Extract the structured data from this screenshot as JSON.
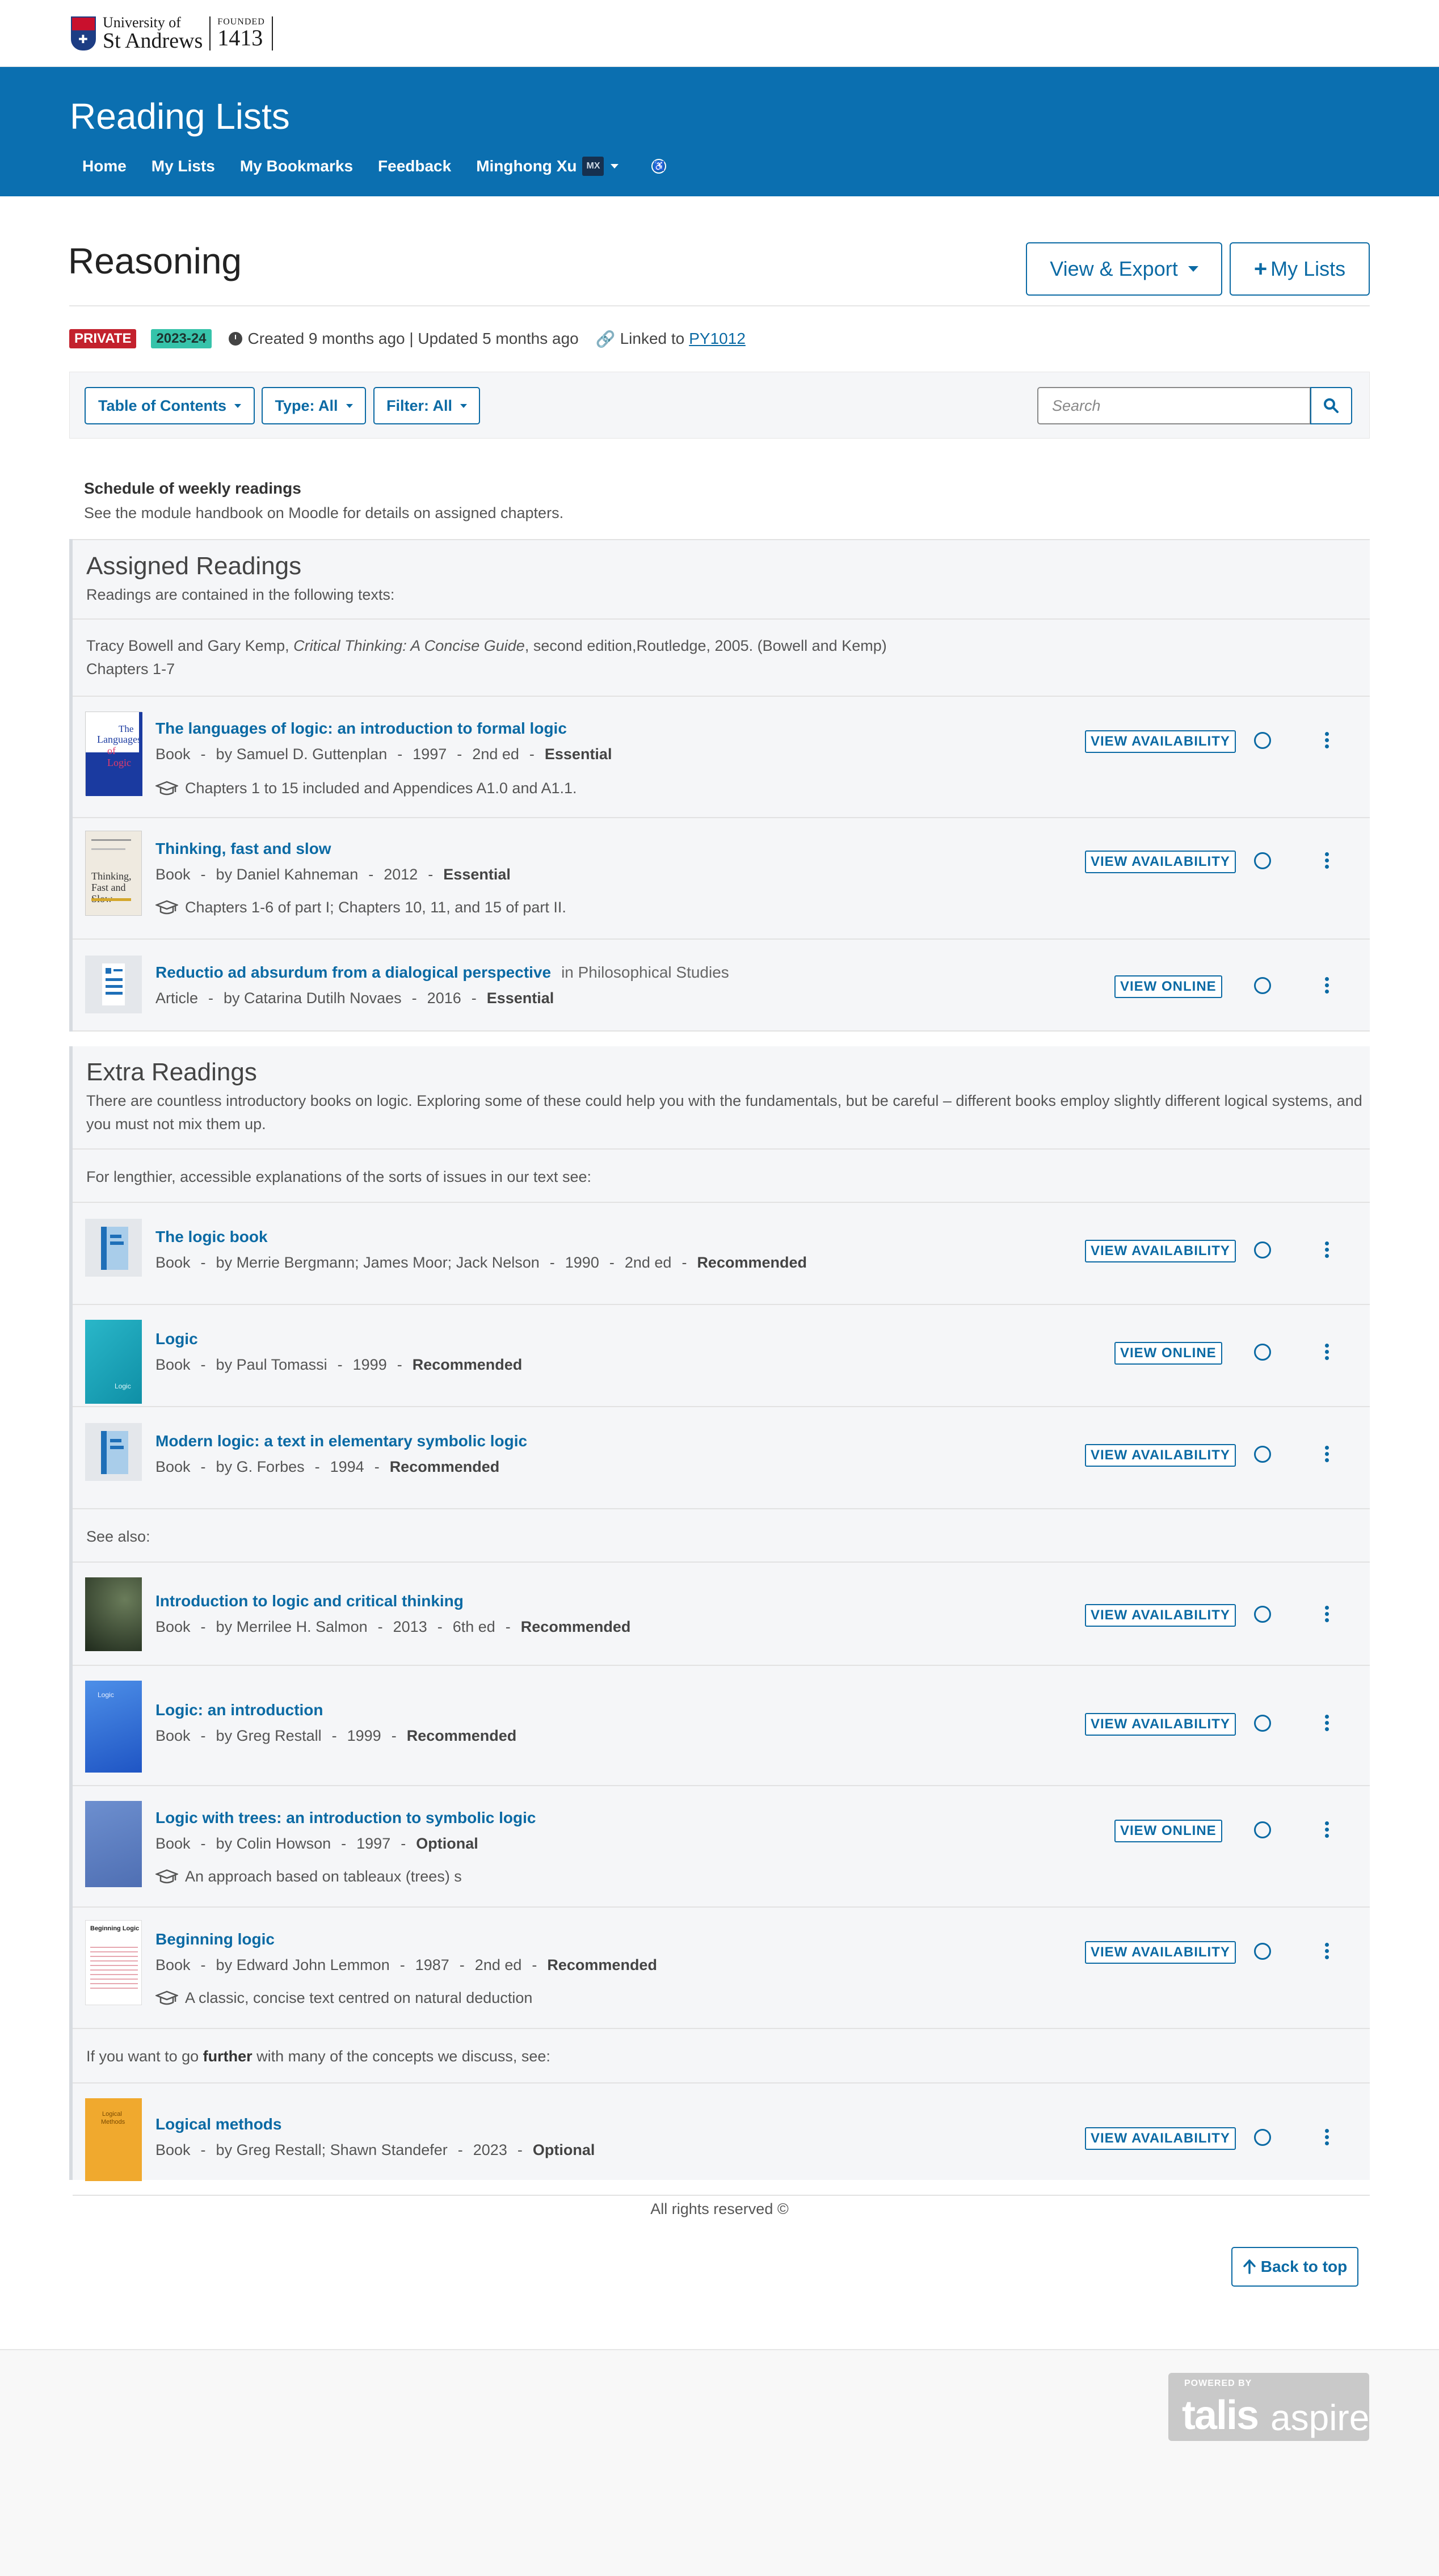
{
  "header": {
    "logo": {
      "line1": "University of",
      "line2": "St Andrews",
      "founded_label": "FOUNDED",
      "founded_year": "1413"
    },
    "app_title": "Reading Lists",
    "nav": {
      "home": "Home",
      "my_lists": "My Lists",
      "my_bookmarks": "My Bookmarks",
      "feedback": "Feedback",
      "user_name": "Minghong Xu",
      "user_initials": "MX"
    }
  },
  "page": {
    "title": "Reasoning",
    "view_export_label": "View & Export",
    "my_lists_label": "My Lists",
    "status_badge": "PRIVATE",
    "year_badge": "2023-24",
    "created_updated": "Created 9 months ago | Updated 5 months ago",
    "linked_label": "Linked to",
    "linked_module": "PY1012"
  },
  "toolbar": {
    "toc_label": "Table of Contents",
    "type_label": "Type: All",
    "filter_label": "Filter: All",
    "search_placeholder": "Search"
  },
  "intro": {
    "title": "Schedule of weekly readings",
    "text": "See the module handbook on Moodle for details on assigned chapters."
  },
  "assigned": {
    "title": "Assigned Readings",
    "desc": "Readings are contained in the following texts:",
    "note_prefix": "Tracy Bowell and Gary Kemp, ",
    "note_italic": "Critical Thinking: A Concise Guide",
    "note_suffix": ", second edition,Routledge, 2005. (Bowell and Kemp)",
    "note_line2": "Chapters 1-7",
    "items": [
      {
        "title": "The languages of logic: an introduction to formal logic",
        "type": "Book",
        "author": "by Samuel D. Guttenplan",
        "year": "1997",
        "edition": "2nd ed",
        "importance": "Essential",
        "note": "Chapters 1 to 15 included and Appendices A1.0 and A1.1.",
        "action": "VIEW AVAILABILITY"
      },
      {
        "title": "Thinking, fast and slow",
        "type": "Book",
        "author": "by Daniel Kahneman",
        "year": "2012",
        "importance": "Essential",
        "note": "Chapters 1-6 of part I; Chapters 10, 11, and 15 of part II.",
        "action": "VIEW AVAILABILITY"
      },
      {
        "title": "Reductio ad absurdum from a dialogical perspective",
        "in": "in Philosophical Studies",
        "type": "Article",
        "author": "by Catarina Dutilh Novaes",
        "year": "2016",
        "importance": "Essential",
        "action": "VIEW ONLINE"
      }
    ]
  },
  "extra": {
    "title": "Extra Readings",
    "desc": "There are countless introductory books on logic. Exploring some of these could help you with the fundamentals, but be careful – different books employ slightly different logical systems, and you must not mix them up.",
    "note1": "For lengthier, accessible explanations of the sorts of issues in our text see:",
    "items1": [
      {
        "title": "The logic book",
        "type": "Book",
        "author": "by Merrie Bergmann; James Moor; Jack Nelson",
        "year": "1990",
        "edition": "2nd ed",
        "importance": "Recommended",
        "action": "VIEW AVAILABILITY"
      },
      {
        "title": "Logic",
        "type": "Book",
        "author": "by Paul Tomassi",
        "year": "1999",
        "importance": "Recommended",
        "action": "VIEW ONLINE"
      },
      {
        "title": "Modern logic: a text in elementary symbolic logic",
        "type": "Book",
        "author": "by G. Forbes",
        "year": "1994",
        "importance": "Recommended",
        "action": "VIEW AVAILABILITY"
      }
    ],
    "note2": "See also:",
    "items2": [
      {
        "title": "Introduction to logic and critical thinking",
        "type": "Book",
        "author": "by Merrilee H. Salmon",
        "year": "2013",
        "edition": "6th ed",
        "importance": "Recommended",
        "action": "VIEW AVAILABILITY"
      },
      {
        "title": "Logic: an introduction",
        "type": "Book",
        "author": "by Greg Restall",
        "year": "1999",
        "importance": "Recommended",
        "action": "VIEW AVAILABILITY"
      },
      {
        "title": "Logic with trees: an introduction to symbolic logic",
        "type": "Book",
        "author": "by Colin Howson",
        "year": "1997",
        "importance": "Optional",
        "note": "An approach based on tableaux (trees) s",
        "action": "VIEW ONLINE"
      },
      {
        "title": "Beginning logic",
        "type": "Book",
        "author": "by Edward John Lemmon",
        "year": "1987",
        "edition": "2nd ed",
        "importance": "Recommended",
        "note": "A classic, concise text centred on natural deduction",
        "action": "VIEW AVAILABILITY"
      }
    ],
    "note3_prefix": "If you want to go ",
    "note3_bold": "further",
    "note3_suffix": " with many of the concepts we discuss, see:",
    "items3": [
      {
        "title": "Logical methods",
        "type": "Book",
        "author": "by Greg Restall; Shawn Standefer",
        "year": "2023",
        "importance": "Optional",
        "action": "VIEW AVAILABILITY"
      }
    ]
  },
  "footer": {
    "rights": "All rights reserved ©",
    "back_to_top": "Back to top",
    "powered_by": "POWERED BY",
    "brand1": "talis",
    "brand2": "aspire"
  },
  "icons": [
    "crest-logo",
    "caret-down-icon",
    "accessibility-icon",
    "plus-icon",
    "clock-icon",
    "link-icon",
    "search-icon",
    "mortarboard-icon",
    "circle-toggle-icon",
    "kebab-menu-icon",
    "arrow-up-icon"
  ],
  "colors": {
    "brand_blue": "#0b6fb0",
    "link_blue": "#0b6aa4",
    "private_red": "#c3212d",
    "year_teal": "#36c3aa"
  }
}
